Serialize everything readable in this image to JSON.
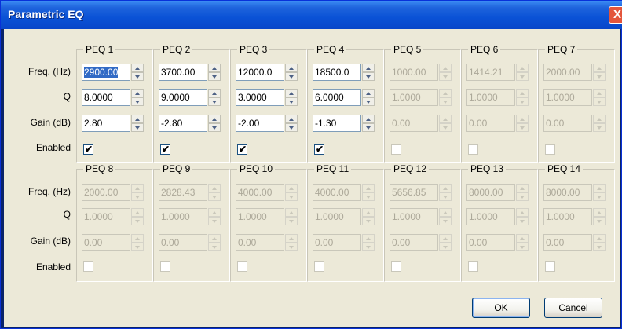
{
  "window": {
    "title": "Parametric EQ",
    "close_glyph": "X"
  },
  "row_labels": {
    "freq": "Freq. (Hz)",
    "q": "Q",
    "gain": "Gain (dB)",
    "enabled": "Enabled"
  },
  "groups_row1": [
    {
      "title": "PEQ 1",
      "freq": "2900.00",
      "q": "8.0000",
      "gain": "2.80",
      "enabled": true,
      "active": true,
      "freq_selected": true
    },
    {
      "title": "PEQ 2",
      "freq": "3700.00",
      "q": "9.0000",
      "gain": "-2.80",
      "enabled": true,
      "active": true
    },
    {
      "title": "PEQ 3",
      "freq": "12000.0",
      "q": "3.0000",
      "gain": "-2.00",
      "enabled": true,
      "active": true
    },
    {
      "title": "PEQ 4",
      "freq": "18500.0",
      "q": "6.0000",
      "gain": "-1.30",
      "enabled": true,
      "active": true
    },
    {
      "title": "PEQ 5",
      "freq": "1000.00",
      "q": "1.0000",
      "gain": "0.00",
      "enabled": false,
      "active": false
    },
    {
      "title": "PEQ 6",
      "freq": "1414.21",
      "q": "1.0000",
      "gain": "0.00",
      "enabled": false,
      "active": false
    },
    {
      "title": "PEQ 7",
      "freq": "2000.00",
      "q": "1.0000",
      "gain": "0.00",
      "enabled": false,
      "active": false
    }
  ],
  "groups_row2": [
    {
      "title": "PEQ 8",
      "freq": "2000.00",
      "q": "1.0000",
      "gain": "0.00",
      "enabled": false,
      "active": false
    },
    {
      "title": "PEQ 9",
      "freq": "2828.43",
      "q": "1.0000",
      "gain": "0.00",
      "enabled": false,
      "active": false
    },
    {
      "title": "PEQ 10",
      "freq": "4000.00",
      "q": "1.0000",
      "gain": "0.00",
      "enabled": false,
      "active": false
    },
    {
      "title": "PEQ 11",
      "freq": "4000.00",
      "q": "1.0000",
      "gain": "0.00",
      "enabled": false,
      "active": false
    },
    {
      "title": "PEQ 12",
      "freq": "5656.85",
      "q": "1.0000",
      "gain": "0.00",
      "enabled": false,
      "active": false
    },
    {
      "title": "PEQ 13",
      "freq": "8000.00",
      "q": "1.0000",
      "gain": "0.00",
      "enabled": false,
      "active": false
    },
    {
      "title": "PEQ 14",
      "freq": "8000.00",
      "q": "1.0000",
      "gain": "0.00",
      "enabled": false,
      "active": false
    }
  ],
  "buttons": {
    "ok": "OK",
    "cancel": "Cancel"
  },
  "colors": {
    "title_bar": "#0a52d6",
    "dialog_bg": "#ece9d8",
    "selection": "#316ac5",
    "close_button": "#e3553c"
  }
}
